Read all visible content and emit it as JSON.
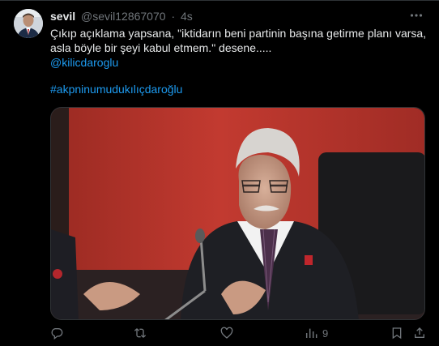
{
  "tweet": {
    "author_name": "sevil",
    "handle": "@sevil12867070",
    "separator": "·",
    "time": "4s",
    "text_line1": "Çıkıp açıklama yapsana, \"iktidarın beni partinin başına getirme planı varsa,",
    "text_line2": "asla böyle bir şeyi kabul etmem.\" desene.....",
    "mention": "@kilicdaroglu",
    "hashtag": "#akpninumudukılıçdaroğlu"
  },
  "actions": {
    "views_count": "9"
  },
  "colors": {
    "background": "#000000",
    "text": "#e7e9ea",
    "secondary": "#71767b",
    "link": "#1d9bf0",
    "border": "#2f3336"
  },
  "icons": [
    "more-icon",
    "reply-icon",
    "retweet-icon",
    "like-icon",
    "views-icon",
    "bookmark-icon",
    "share-icon"
  ]
}
